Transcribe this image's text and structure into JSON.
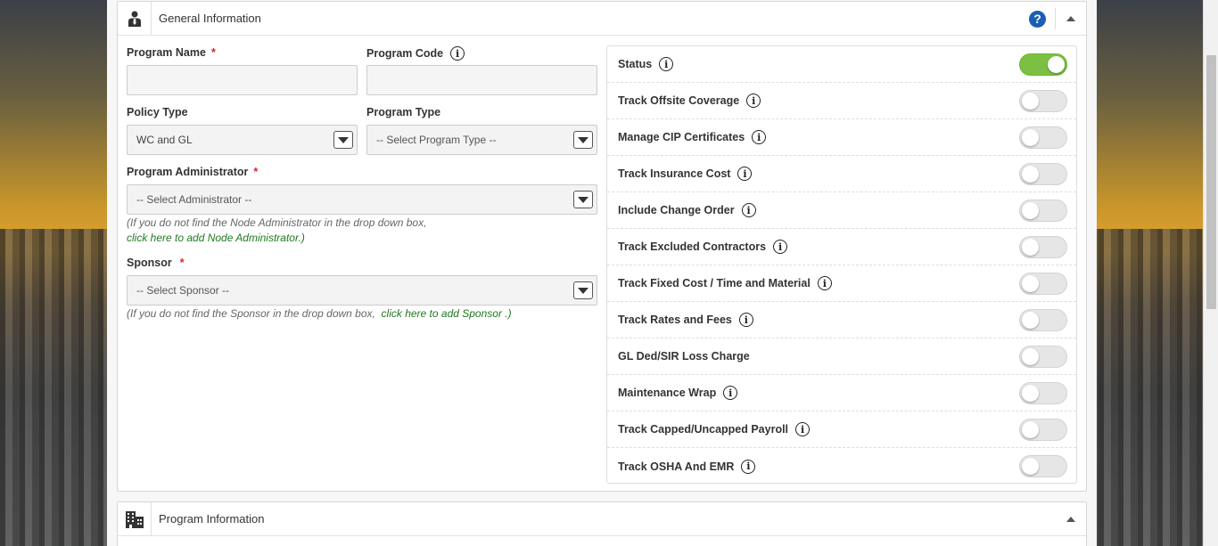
{
  "general_panel": {
    "title": "General Information",
    "help_icon": "question-circle-icon",
    "collapse_icon": "caret-up-icon",
    "header_icon": "person-tie-icon"
  },
  "form": {
    "program_name_label": "Program Name",
    "program_name_value": "",
    "program_code_label": "Program Code",
    "program_code_value": "",
    "policy_type_label": "Policy Type",
    "policy_type_value": "WC and GL",
    "program_type_label": "Program Type",
    "program_type_value": "-- Select Program Type --",
    "admin_label": "Program Administrator",
    "admin_value": "-- Select Administrator --",
    "admin_hint": "(If you do not find the Node Administrator in the drop down box,",
    "admin_hint_link": "click here to add Node Administrator.)",
    "sponsor_label": "Sponsor",
    "sponsor_value": "-- Select Sponsor --",
    "sponsor_hint": "(If you do not find the Sponsor in the drop down box,",
    "sponsor_hint_link": "click here to add Sponsor .)",
    "required_mark": "*",
    "info_glyph": "i"
  },
  "toggles": [
    {
      "label": "Status",
      "on": true,
      "info": true
    },
    {
      "label": "Track Offsite Coverage",
      "on": false,
      "info": true
    },
    {
      "label": "Manage CIP Certificates",
      "on": false,
      "info": true
    },
    {
      "label": "Track Insurance Cost",
      "on": false,
      "info": true
    },
    {
      "label": "Include Change Order",
      "on": false,
      "info": true
    },
    {
      "label": "Track Excluded Contractors",
      "on": false,
      "info": true
    },
    {
      "label": "Track Fixed Cost / Time and Material",
      "on": false,
      "info": true
    },
    {
      "label": "Track Rates and Fees",
      "on": false,
      "info": true
    },
    {
      "label": "GL Ded/SIR Loss Charge",
      "on": false,
      "info": false
    },
    {
      "label": "Maintenance Wrap",
      "on": false,
      "info": true
    },
    {
      "label": "Track Capped/Uncapped Payroll",
      "on": false,
      "info": true
    },
    {
      "label": "Track OSHA And EMR",
      "on": false,
      "info": true
    }
  ],
  "program_panel": {
    "title": "Program Information",
    "header_icon": "building-icon",
    "collapse_icon": "caret-up-icon"
  },
  "colors": {
    "toggle_on": "#7bc043",
    "help_blue": "#1a5fb4",
    "required_red": "#d9232d",
    "link_green": "#1f7a1f"
  }
}
